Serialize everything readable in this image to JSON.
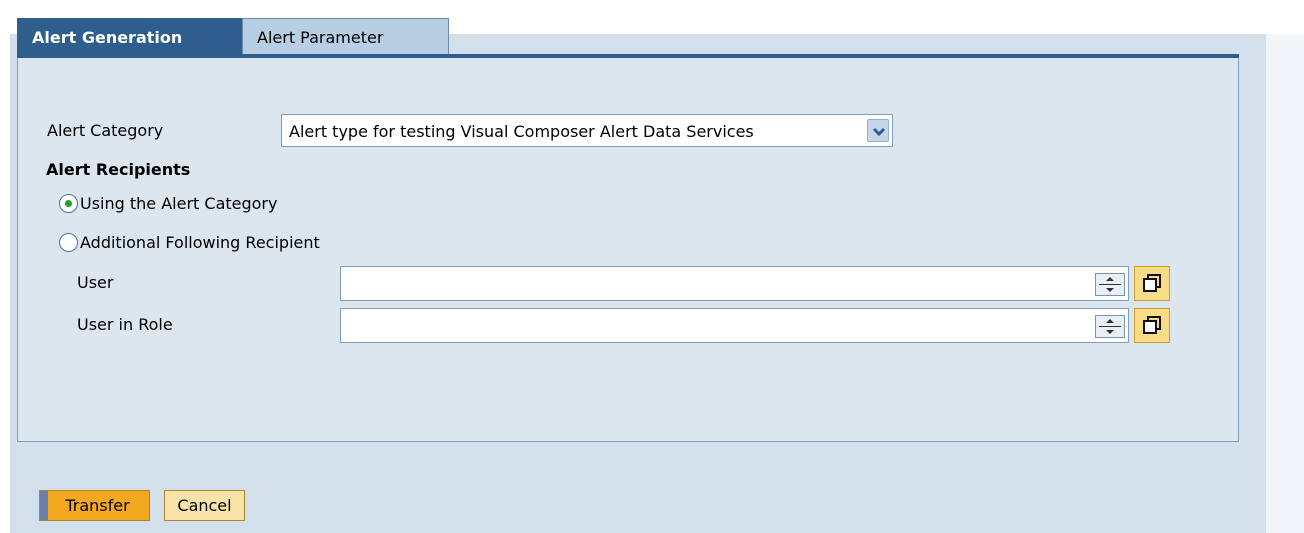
{
  "tabs": {
    "generation": "Alert Generation",
    "parameter": "Alert Parameter"
  },
  "form": {
    "category_label": "Alert Category",
    "category_value": "Alert type for testing Visual Composer Alert Data Services",
    "recipients_heading": "Alert Recipients",
    "radio_category": "Using the Alert Category",
    "radio_category_selected": true,
    "radio_additional": "Additional Following Recipient",
    "radio_additional_selected": false,
    "user_label": "User",
    "user_value": "",
    "role_label": "User in Role",
    "role_value": ""
  },
  "buttons": {
    "transfer": "Transfer",
    "cancel": "Cancel"
  },
  "icons": {
    "dropdown": "chevron-down-icon",
    "spinner": "spinner-icon",
    "value_help": "value-help-icon"
  },
  "colors": {
    "tab_active": "#2e5d8e",
    "tab_inactive": "#b8cfe3",
    "panel": "#dbe6ef",
    "primary_button": "#f4a81f",
    "secondary_button": "#f8e3a8",
    "radio_selected": "#2a9a2a"
  }
}
